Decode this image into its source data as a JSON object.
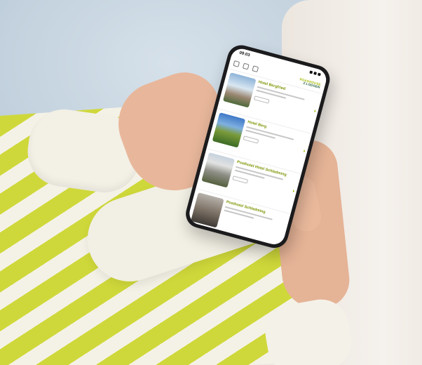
{
  "statusbar": {
    "time": "09:03"
  },
  "brand": {
    "line1": "ROADHOUSE",
    "line2": "Z.LODGEN"
  },
  "cards": [
    {
      "title": "Hotel Bergfried"
    },
    {
      "title": "Hotel Berg"
    },
    {
      "title": "Posthotel Hotel Schladming"
    },
    {
      "title": "Posthotel Schladming"
    }
  ],
  "colors": {
    "brand_lime": "#a4b800",
    "brand_green": "#1d5a3c"
  }
}
